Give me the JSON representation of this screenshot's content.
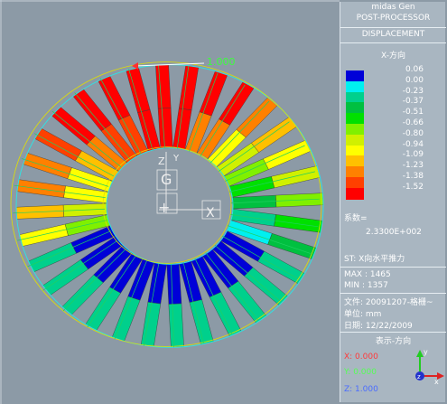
{
  "window": {
    "app_name": "midas Gen",
    "mode": "POST-PROCESSOR",
    "result_type": "DISPLACEMENT"
  },
  "legend": {
    "direction_label": "X-方向",
    "values": [
      "0.06",
      "0.00",
      "-0.23",
      "-0.37",
      "-0.51",
      "-0.66",
      "-0.80",
      "-0.94",
      "-1.09",
      "-1.23",
      "-1.38",
      "-1.52"
    ],
    "colors": [
      "#0000d8",
      "#00f0f0",
      "#00d08c",
      "#00c040",
      "#00e000",
      "#80f000",
      "#d0f000",
      "#ffff00",
      "#ffc000",
      "#ff8000",
      "#ff4000",
      "#ff0000"
    ]
  },
  "factor": {
    "label": "系数=",
    "value": "2.3300E+002"
  },
  "load_case": "ST: X向水平推力",
  "max_node": "MAX : 1465",
  "min_node": "MIN : 1357",
  "file_info": {
    "file": "文件: 20091207-格栅~",
    "unit": "单位: mm",
    "date": "日期: 12/22/2009"
  },
  "view_direction": {
    "title": "表示-方向",
    "x": "X: 0.000",
    "y": "Y: 0.000",
    "z": "Z: 1.000"
  },
  "viewport": {
    "scale_label": "1.000",
    "axis_z_label": "Z",
    "axis_x_label": "X",
    "axis_y_label": "Y",
    "origin_label": "G",
    "triad_labels": {
      "x": "x",
      "y": "y",
      "z": "z"
    }
  }
}
